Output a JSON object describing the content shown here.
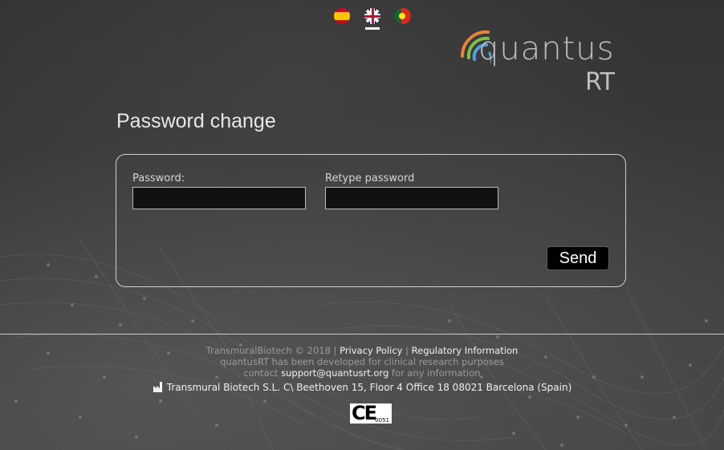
{
  "languages": [
    {
      "name": "Español",
      "icon": "spain-flag-icon"
    },
    {
      "name": "English",
      "icon": "uk-flag-icon",
      "active": true
    },
    {
      "name": "Português",
      "icon": "portugal-flag-icon"
    }
  ],
  "logo": {
    "word": "quantus",
    "suffix": "RT"
  },
  "page": {
    "title": "Password change"
  },
  "form": {
    "password_label": "Password:",
    "password_value": "",
    "retype_label": "Retype password",
    "retype_value": "",
    "send_label": "Send"
  },
  "footer": {
    "copyright": "TransmuralBiotech © 2018 |",
    "privacy_link": "Privacy Policy",
    "separator": "|",
    "regulatory_link": "Regulatory Information",
    "developed": "quantusRT has been developed for clinical research purposes",
    "contact_prefix": "contact",
    "contact_email": "support@quantusrt.org",
    "contact_suffix": "for any information",
    "address": "Transmural Biotech S.L. C\\ Beethoven 15, Floor 4 Office 18 08021 Barcelona (Spain)",
    "ce_mark": "CE",
    "ce_number": "0051"
  },
  "colors": {
    "background": "#3a3a3a",
    "logo_arc_orange": "#e8833a",
    "logo_arc_green": "#7fbf4a",
    "logo_arc_blue": "#4aa3df",
    "input_background": "#111111",
    "button_background": "#000000"
  }
}
